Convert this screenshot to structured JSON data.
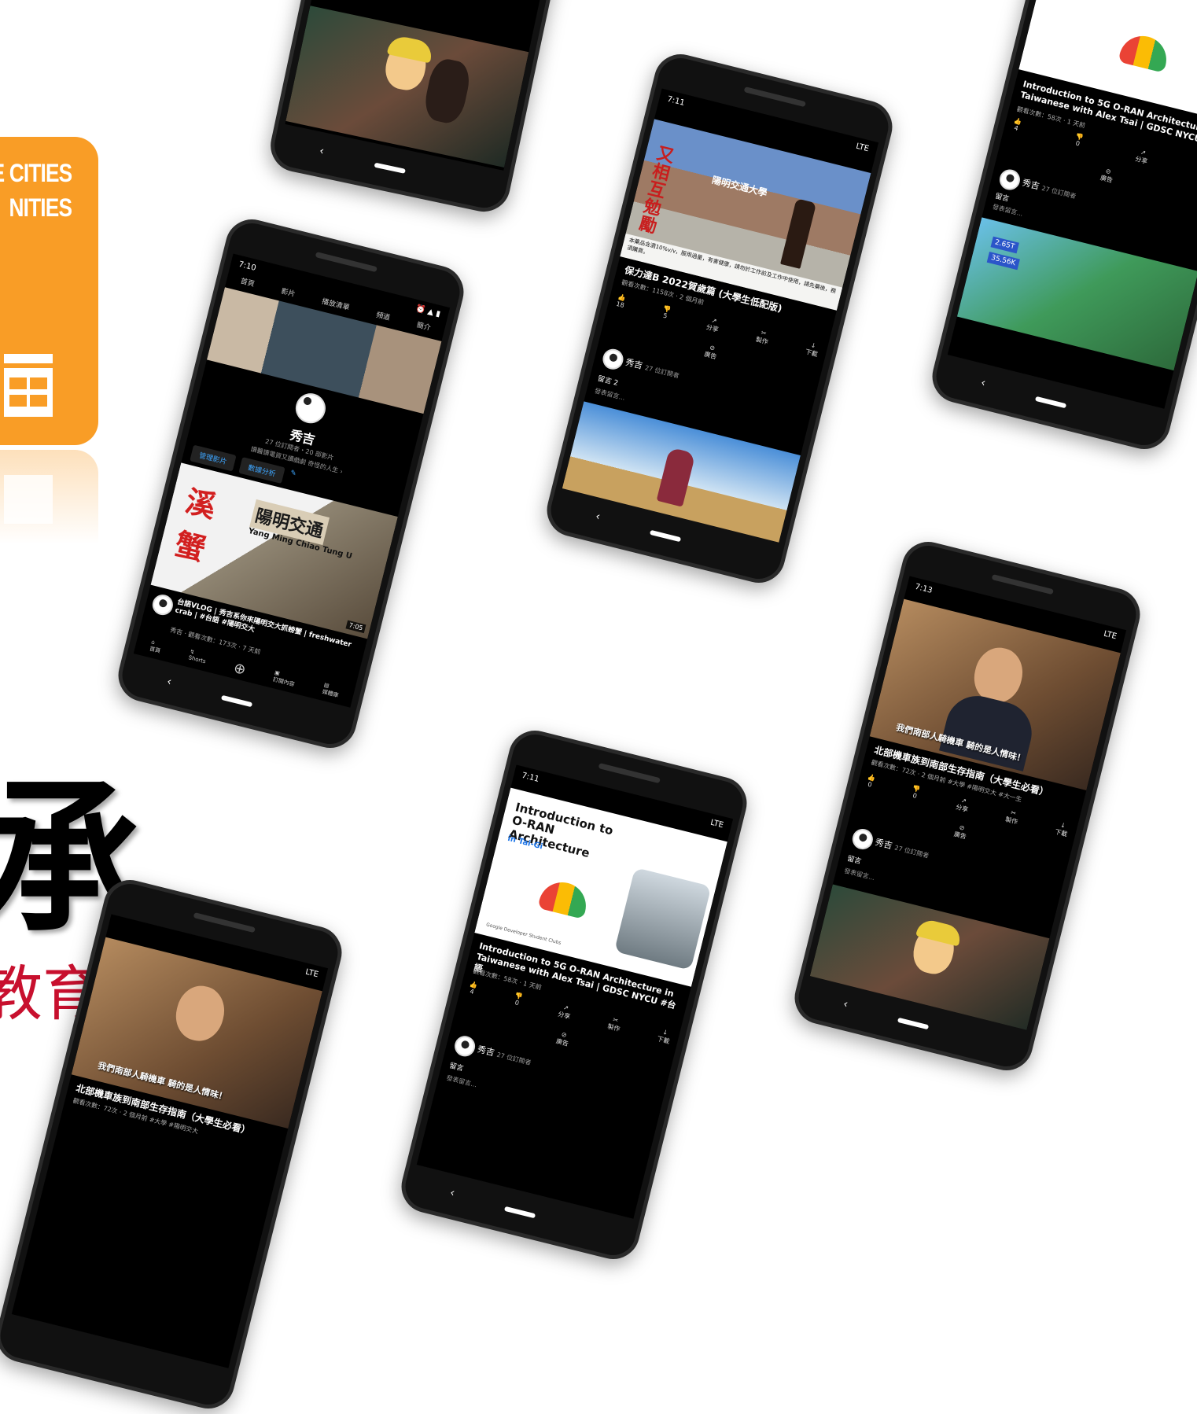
{
  "sdg_panel": {
    "line1": "E CITIES",
    "line2": "NITIES",
    "icon": "city-grid-icon",
    "color": "#f99d26"
  },
  "headline": {
    "character": "承",
    "subtitle": "教育",
    "subtitle_color": "#c8102e"
  },
  "phones": {
    "channel": {
      "time": "7:10",
      "tabs": [
        "首頁",
        "影片",
        "播放清單",
        "頻道",
        "簡介"
      ],
      "channel_name": "秀吉",
      "channel_stats": "27 位訂閱者・20 部影片",
      "channel_desc": "讀醫讀電資又讀戲劇 奇怪的人生 ›",
      "btn_manage": "管理影片",
      "btn_analytics": "數據分析",
      "thumb_text_1": "溪",
      "thumb_text_2": "蟹",
      "thumb_sign": "陽明交通",
      "thumb_sign_en": "Yang Ming Chiao Tung U",
      "duration": "7:05",
      "video_title": "台語VLOG | 秀吉系你來陽明交大抓螃蟹 | freshwater crab | #台語 #陽明交大",
      "video_meta": "秀吉 · 觀看次數：173次 · 7 天前",
      "nav": [
        "首頁",
        "Shorts",
        "",
        "訂閱內容",
        "媒體庫"
      ]
    },
    "ad": {
      "time": "7:11",
      "status_right": "LTE",
      "overlay_text": "又相互勉勵",
      "sign_text": "陽明交通大學",
      "warning": "本藥品含酒10%v/v，服用過量，有害健康，請勿於工作前及工作中使用，請先藥後，務須購買。",
      "title": "保力達B 2022賀歲篇 (大學生低配版)",
      "meta": "觀看次數：1158次 · 2 個月前",
      "actions": [
        {
          "label": "18",
          "icon": "thumbs-up-icon"
        },
        {
          "label": "5",
          "icon": "thumbs-down-icon"
        },
        {
          "label": "分享",
          "icon": "share-icon"
        },
        {
          "label": "製作",
          "icon": "remix-icon"
        },
        {
          "label": "下載",
          "icon": "download-icon"
        }
      ],
      "ads_label": "廣告",
      "channel_name": "秀吉",
      "subs": "27 位訂閱者",
      "comments_label": "留言 2",
      "comment_placeholder": "發表留言..."
    },
    "oran_right": {
      "title": "Introduction to 5G O-RAN Architecture Taiwanese with Alex Tsai | GDSC NYCU",
      "meta": "觀看次數：58次 · 1 天前",
      "likes": "4",
      "dislikes": "0",
      "share": "分享",
      "remix": "製作",
      "ads_label": "廣告",
      "channel_name": "秀吉",
      "subs": "27 位訂閱者",
      "comments_label": "留言",
      "comment_placeholder": "發表留言...",
      "game_val1": "2.65T",
      "game_val2": "35.56K"
    },
    "oran_center": {
      "time": "7:11",
      "status_right": "LTE",
      "slide_title": "Introduction to O-RAN Architecture",
      "slide_sub": "in Tai-Gi",
      "gdsc_label": "Google Developer Student Clubs",
      "title": "Introduction to 5G O-RAN Architecture in Taiwanese with Alex Tsai | GDSC NYCU #台語",
      "meta": "觀看次數：58次 · 1 天前",
      "likes": "4",
      "dislikes": "0",
      "share": "分享",
      "remix": "製作",
      "download": "下載",
      "ads_label": "廣告",
      "channel_name": "秀吉",
      "subs": "27 位訂閱者",
      "comments_label": "留言",
      "comment_placeholder": "發表留言..."
    },
    "moto_right": {
      "time": "7:13",
      "status_right": "LTE",
      "subtitle": "我們南部人騎機車 騎的是人情味！",
      "title": "北部機車族到南部生存指南（大學生必看）",
      "meta": "觀看次數：72次 · 2 個月前 #大學 #陽明交大 #大一生",
      "likes": "0",
      "dislikes": "0",
      "share": "分享",
      "remix": "製作",
      "download": "下載",
      "ads_label": "廣告",
      "channel_name": "秀吉",
      "subs": "27 位訂閱者",
      "comments_label": "留言",
      "comment_placeholder": "發表留言..."
    },
    "moto_left": {
      "status_right": "LTE",
      "subtitle": "我們南部人騎機車 騎的是人情味！",
      "title": "北部機車族到南部生存指南（大學生必看）",
      "meta": "觀看次數：72次 · 2 個月前 #大學 #陽明交大"
    }
  }
}
